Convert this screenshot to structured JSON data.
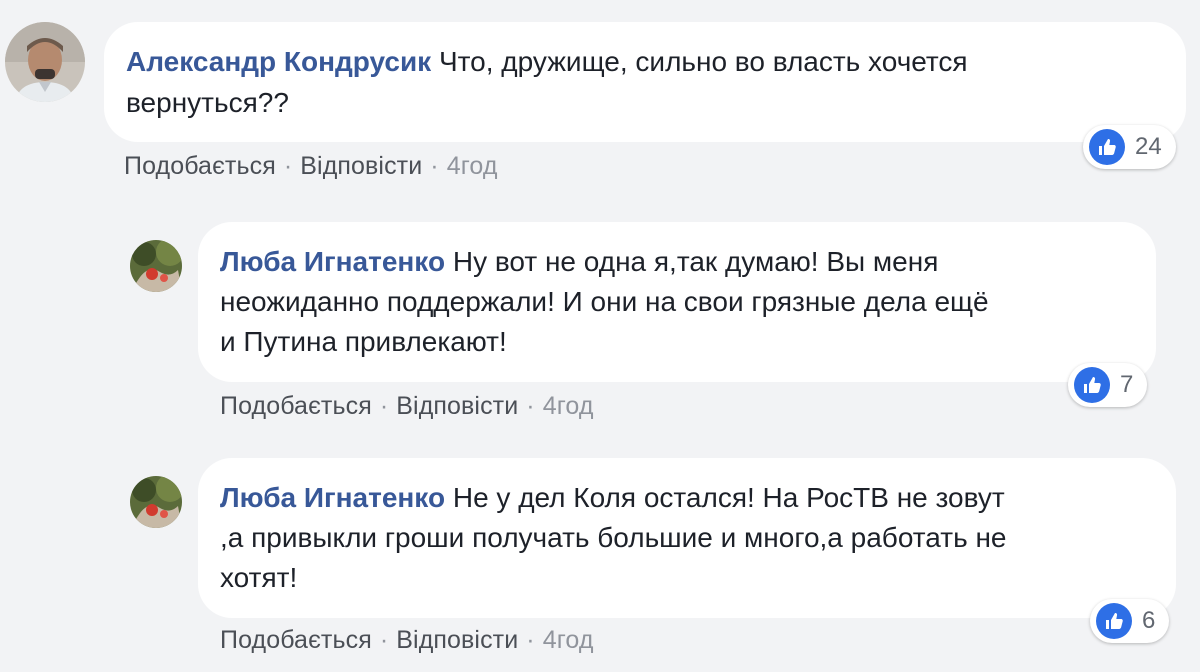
{
  "comments": [
    {
      "author": "Александр Кондрусик",
      "lines": [
        "Что, дружище, сильно во власть хочется",
        "вернуться??"
      ],
      "actions": {
        "like": "Подобається",
        "reply": "Відповісти",
        "time": "4год"
      },
      "reactions": {
        "icon": "like-icon",
        "count": "24"
      }
    },
    {
      "author": "Люба Игнатенко",
      "lines": [
        "Ну вот не одна я,так думаю! Вы меня",
        "неожиданно поддержали! И они на свои грязные дела ещё",
        "и Путина привлекают!"
      ],
      "actions": {
        "like": "Подобається",
        "reply": "Відповісти",
        "time": "4год"
      },
      "reactions": {
        "icon": "like-icon",
        "count": "7"
      }
    },
    {
      "author": "Люба Игнатенко",
      "lines": [
        "Не у дел Коля остался! На РосТВ не зовут",
        ",а привыкли гроши получать большие и много,а работать не",
        "хотят!"
      ],
      "actions": {
        "like": "Подобається",
        "reply": "Відповісти",
        "time": "4год"
      },
      "reactions": {
        "icon": "like-icon",
        "count": "6"
      }
    }
  ],
  "separator": "·",
  "colors": {
    "background": "#f2f3f5",
    "author": "#385898",
    "like": "#2e6fe6"
  }
}
